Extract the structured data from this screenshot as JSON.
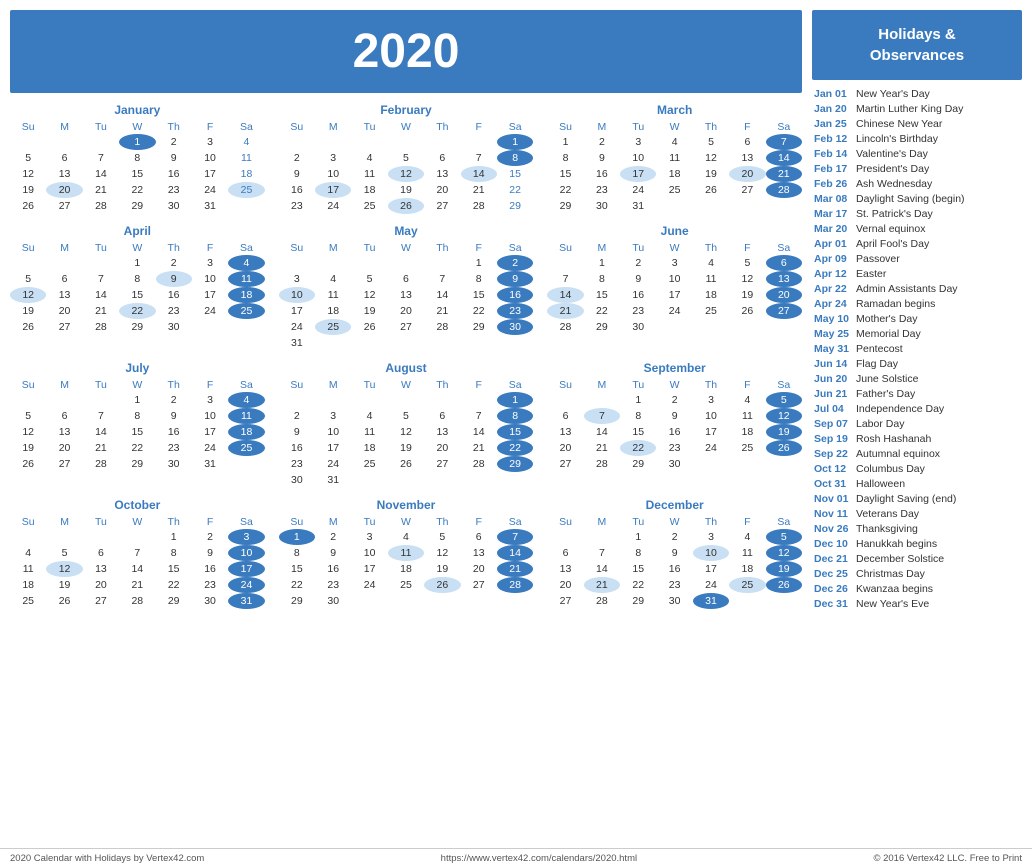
{
  "header": {
    "year": "2020"
  },
  "holidays_title": "Holidays &\nObservances",
  "holidays": [
    {
      "date": "Jan 01",
      "name": "New Year's Day"
    },
    {
      "date": "Jan 20",
      "name": "Martin Luther King Day"
    },
    {
      "date": "Jan 25",
      "name": "Chinese New Year"
    },
    {
      "date": "Feb 12",
      "name": "Lincoln's Birthday"
    },
    {
      "date": "Feb 14",
      "name": "Valentine's Day"
    },
    {
      "date": "Feb 17",
      "name": "President's Day"
    },
    {
      "date": "Feb 26",
      "name": "Ash Wednesday"
    },
    {
      "date": "Mar 08",
      "name": "Daylight Saving (begin)"
    },
    {
      "date": "Mar 17",
      "name": "St. Patrick's Day"
    },
    {
      "date": "Mar 20",
      "name": "Vernal equinox"
    },
    {
      "date": "Apr 01",
      "name": "April Fool's Day"
    },
    {
      "date": "Apr 09",
      "name": "Passover"
    },
    {
      "date": "Apr 12",
      "name": "Easter"
    },
    {
      "date": "Apr 22",
      "name": "Admin Assistants Day"
    },
    {
      "date": "Apr 24",
      "name": "Ramadan begins"
    },
    {
      "date": "May 10",
      "name": "Mother's Day"
    },
    {
      "date": "May 25",
      "name": "Memorial Day"
    },
    {
      "date": "May 31",
      "name": "Pentecost"
    },
    {
      "date": "Jun 14",
      "name": "Flag Day"
    },
    {
      "date": "Jun 20",
      "name": "June Solstice"
    },
    {
      "date": "Jun 21",
      "name": "Father's Day"
    },
    {
      "date": "Jul 04",
      "name": "Independence Day"
    },
    {
      "date": "Sep 07",
      "name": "Labor Day"
    },
    {
      "date": "Sep 19",
      "name": "Rosh Hashanah"
    },
    {
      "date": "Sep 22",
      "name": "Autumnal equinox"
    },
    {
      "date": "Oct 12",
      "name": "Columbus Day"
    },
    {
      "date": "Oct 31",
      "name": "Halloween"
    },
    {
      "date": "Nov 01",
      "name": "Daylight Saving (end)"
    },
    {
      "date": "Nov 11",
      "name": "Veterans Day"
    },
    {
      "date": "Nov 26",
      "name": "Thanksgiving"
    },
    {
      "date": "Dec 10",
      "name": "Hanukkah begins"
    },
    {
      "date": "Dec 21",
      "name": "December Solstice"
    },
    {
      "date": "Dec 25",
      "name": "Christmas Day"
    },
    {
      "date": "Dec 26",
      "name": "Kwanzaa begins"
    },
    {
      "date": "Dec 31",
      "name": "New Year's Eve"
    }
  ],
  "footer": {
    "left": "2020 Calendar with Holidays by Vertex42.com",
    "center": "https://www.vertex42.com/calendars/2020.html",
    "right": "© 2016 Vertex42 LLC. Free to Print"
  },
  "months": [
    {
      "name": "January",
      "weeks": [
        [
          "",
          "",
          "",
          "1",
          "2",
          "3",
          "4"
        ],
        [
          "5",
          "6",
          "7",
          "8",
          "9",
          "10",
          "11"
        ],
        [
          "12",
          "13",
          "14",
          "15",
          "16",
          "17",
          "18"
        ],
        [
          "19",
          "20",
          "21",
          "22",
          "23",
          "24",
          "25"
        ],
        [
          "26",
          "27",
          "28",
          "29",
          "30",
          "31",
          ""
        ]
      ],
      "highlights_blue": [
        "1"
      ],
      "highlights_light": [
        "20",
        "25"
      ]
    },
    {
      "name": "February",
      "weeks": [
        [
          "",
          "",
          "",
          "",
          "",
          "",
          "1"
        ],
        [
          "2",
          "3",
          "4",
          "5",
          "6",
          "7",
          "8"
        ],
        [
          "9",
          "10",
          "11",
          "12",
          "13",
          "14",
          "15"
        ],
        [
          "16",
          "17",
          "18",
          "19",
          "20",
          "21",
          "22"
        ],
        [
          "23",
          "24",
          "25",
          "26",
          "27",
          "28",
          "29"
        ]
      ],
      "highlights_blue": [
        "1",
        "8"
      ],
      "highlights_light": [
        "12",
        "14",
        "17",
        "26"
      ]
    },
    {
      "name": "March",
      "weeks": [
        [
          "1",
          "2",
          "3",
          "4",
          "5",
          "6",
          "7"
        ],
        [
          "8",
          "9",
          "10",
          "11",
          "12",
          "13",
          "14"
        ],
        [
          "15",
          "16",
          "17",
          "18",
          "19",
          "20",
          "21"
        ],
        [
          "22",
          "23",
          "24",
          "25",
          "26",
          "27",
          "28"
        ],
        [
          "29",
          "30",
          "31",
          "",
          "",
          "",
          ""
        ]
      ],
      "highlights_blue": [
        "7",
        "14",
        "21",
        "28"
      ],
      "highlights_light": [
        "17",
        "20"
      ]
    },
    {
      "name": "April",
      "weeks": [
        [
          "",
          "",
          "",
          "1",
          "2",
          "3",
          "4"
        ],
        [
          "5",
          "6",
          "7",
          "8",
          "9",
          "10",
          "11"
        ],
        [
          "12",
          "13",
          "14",
          "15",
          "16",
          "17",
          "18"
        ],
        [
          "19",
          "20",
          "21",
          "22",
          "23",
          "24",
          "25"
        ],
        [
          "26",
          "27",
          "28",
          "29",
          "30",
          "",
          ""
        ]
      ],
      "highlights_blue": [
        "4",
        "11",
        "18",
        "25"
      ],
      "highlights_light": [
        "9",
        "12",
        "22"
      ]
    },
    {
      "name": "May",
      "weeks": [
        [
          "",
          "",
          "",
          "",
          "",
          "1",
          "2"
        ],
        [
          "3",
          "4",
          "5",
          "6",
          "7",
          "8",
          "9"
        ],
        [
          "10",
          "11",
          "12",
          "13",
          "14",
          "15",
          "16"
        ],
        [
          "17",
          "18",
          "19",
          "20",
          "21",
          "22",
          "23"
        ],
        [
          "24",
          "25",
          "26",
          "27",
          "28",
          "29",
          "30"
        ],
        [
          "31",
          "",
          "",
          "",
          "",
          "",
          ""
        ]
      ],
      "highlights_blue": [
        "2",
        "9",
        "16",
        "23",
        "30"
      ],
      "highlights_light": [
        "10",
        "25"
      ]
    },
    {
      "name": "June",
      "weeks": [
        [
          "",
          "1",
          "2",
          "3",
          "4",
          "5",
          "6"
        ],
        [
          "7",
          "8",
          "9",
          "10",
          "11",
          "12",
          "13"
        ],
        [
          "14",
          "15",
          "16",
          "17",
          "18",
          "19",
          "20"
        ],
        [
          "21",
          "22",
          "23",
          "24",
          "25",
          "26",
          "27"
        ],
        [
          "28",
          "29",
          "30",
          "",
          "",
          "",
          ""
        ]
      ],
      "highlights_blue": [
        "6",
        "13",
        "20",
        "27"
      ],
      "highlights_light": [
        "14",
        "21"
      ]
    },
    {
      "name": "July",
      "weeks": [
        [
          "",
          "",
          "",
          "1",
          "2",
          "3",
          "4"
        ],
        [
          "5",
          "6",
          "7",
          "8",
          "9",
          "10",
          "11"
        ],
        [
          "12",
          "13",
          "14",
          "15",
          "16",
          "17",
          "18"
        ],
        [
          "19",
          "20",
          "21",
          "22",
          "23",
          "24",
          "25"
        ],
        [
          "26",
          "27",
          "28",
          "29",
          "30",
          "31",
          ""
        ]
      ],
      "highlights_blue": [
        "4",
        "11",
        "18",
        "25"
      ],
      "highlights_light": []
    },
    {
      "name": "August",
      "weeks": [
        [
          "",
          "",
          "",
          "",
          "",
          "",
          "1"
        ],
        [
          "2",
          "3",
          "4",
          "5",
          "6",
          "7",
          "8"
        ],
        [
          "9",
          "10",
          "11",
          "12",
          "13",
          "14",
          "15"
        ],
        [
          "16",
          "17",
          "18",
          "19",
          "20",
          "21",
          "22"
        ],
        [
          "23",
          "24",
          "25",
          "26",
          "27",
          "28",
          "29"
        ],
        [
          "30",
          "31",
          "",
          "",
          "",
          "",
          ""
        ]
      ],
      "highlights_blue": [
        "1",
        "8",
        "15",
        "22",
        "29"
      ],
      "highlights_light": []
    },
    {
      "name": "September",
      "weeks": [
        [
          "",
          "",
          "1",
          "2",
          "3",
          "4",
          "5"
        ],
        [
          "6",
          "7",
          "8",
          "9",
          "10",
          "11",
          "12"
        ],
        [
          "13",
          "14",
          "15",
          "16",
          "17",
          "18",
          "19"
        ],
        [
          "20",
          "21",
          "22",
          "23",
          "24",
          "25",
          "26"
        ],
        [
          "27",
          "28",
          "29",
          "30",
          "",
          "",
          ""
        ]
      ],
      "highlights_blue": [
        "5",
        "12",
        "19",
        "26"
      ],
      "highlights_light": [
        "7",
        "22"
      ]
    },
    {
      "name": "October",
      "weeks": [
        [
          "",
          "",
          "",
          "",
          "1",
          "2",
          "3"
        ],
        [
          "4",
          "5",
          "6",
          "7",
          "8",
          "9",
          "10"
        ],
        [
          "11",
          "12",
          "13",
          "14",
          "15",
          "16",
          "17"
        ],
        [
          "18",
          "19",
          "20",
          "21",
          "22",
          "23",
          "24"
        ],
        [
          "25",
          "26",
          "27",
          "28",
          "29",
          "30",
          "31"
        ]
      ],
      "highlights_blue": [
        "3",
        "10",
        "17",
        "24",
        "31"
      ],
      "highlights_light": [
        "12"
      ]
    },
    {
      "name": "November",
      "weeks": [
        [
          "1",
          "2",
          "3",
          "4",
          "5",
          "6",
          "7"
        ],
        [
          "8",
          "9",
          "10",
          "11",
          "12",
          "13",
          "14"
        ],
        [
          "15",
          "16",
          "17",
          "18",
          "19",
          "20",
          "21"
        ],
        [
          "22",
          "23",
          "24",
          "25",
          "26",
          "27",
          "28"
        ],
        [
          "29",
          "30",
          "",
          "",
          "",
          "",
          ""
        ]
      ],
      "highlights_blue": [
        "1",
        "7",
        "14",
        "21",
        "28"
      ],
      "highlights_light": [
        "11",
        "26"
      ]
    },
    {
      "name": "December",
      "weeks": [
        [
          "",
          "",
          "1",
          "2",
          "3",
          "4",
          "5"
        ],
        [
          "6",
          "7",
          "8",
          "9",
          "10",
          "11",
          "12"
        ],
        [
          "13",
          "14",
          "15",
          "16",
          "17",
          "18",
          "19"
        ],
        [
          "20",
          "21",
          "22",
          "23",
          "24",
          "25",
          "26"
        ],
        [
          "27",
          "28",
          "29",
          "30",
          "31",
          "",
          ""
        ]
      ],
      "highlights_blue": [
        "5",
        "12",
        "19",
        "26",
        "31"
      ],
      "highlights_light": [
        "10",
        "21",
        "25"
      ]
    }
  ]
}
